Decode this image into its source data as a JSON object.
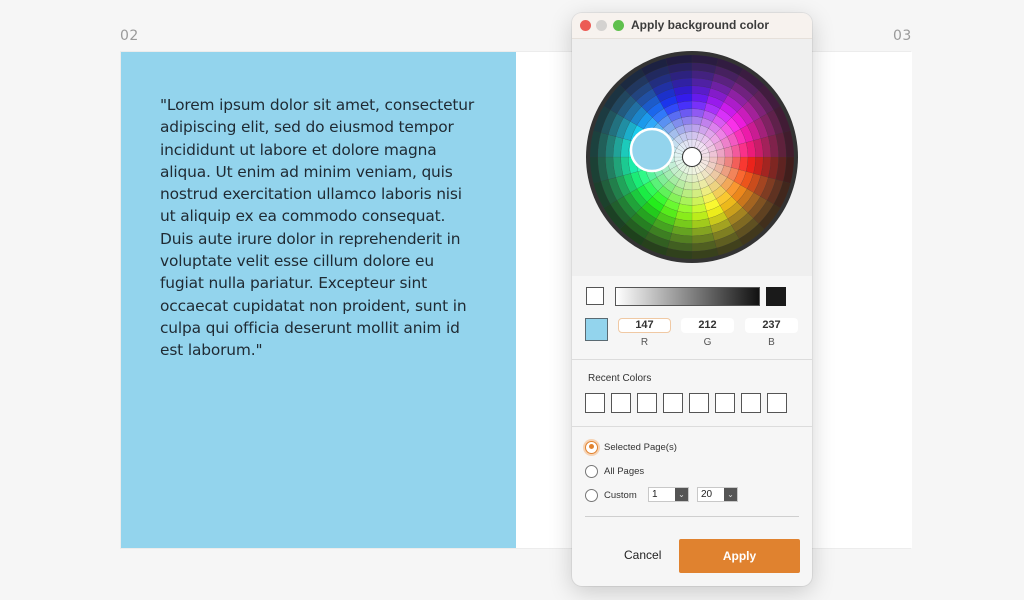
{
  "document": {
    "left_page_number": "02",
    "right_page_number": "03",
    "left_page_background": "#93d4ed",
    "quote_text": "\"Lorem ipsum dolor sit amet, consectetur adipiscing elit, sed do eiusmod tempor incididunt ut labore et dolore magna aliqua. Ut enim ad minim veniam, quis nostrud exercitation ullamco laboris nisi ut aliquip ex ea commodo consequat. Duis aute irure dolor in reprehenderit in voluptate velit esse cillum dolore eu fugiat nulla pariatur. Excepteur sint occaecat cupidatat non proident, sunt in culpa qui officia deserunt mollit anim id est laborum.\""
  },
  "dialog": {
    "title": "Apply background color",
    "window_controls": [
      "close",
      "minimize",
      "zoom"
    ],
    "color_wheel": {
      "selected_color": "#93d4ed"
    },
    "grayscale": {
      "start_swatch": "#ffffff",
      "end_swatch": "#1a1a1a"
    },
    "current_color": "#93d4ed",
    "rgb": {
      "r": "147",
      "g": "212",
      "b": "237",
      "r_label": "R",
      "g_label": "G",
      "b_label": "B"
    },
    "recent_colors": {
      "label": "Recent Colors",
      "swatches": [
        "",
        "",
        "",
        "",
        "",
        "",
        "",
        ""
      ]
    },
    "apply_to": {
      "options": [
        {
          "label": "Selected Page(s)",
          "selected": true
        },
        {
          "label": "All Pages",
          "selected": false
        },
        {
          "label": "Custom",
          "selected": false
        }
      ],
      "custom_from": "1",
      "custom_to": "20"
    },
    "cancel_label": "Cancel",
    "apply_label": "Apply",
    "accent_color": "#e0822f"
  }
}
